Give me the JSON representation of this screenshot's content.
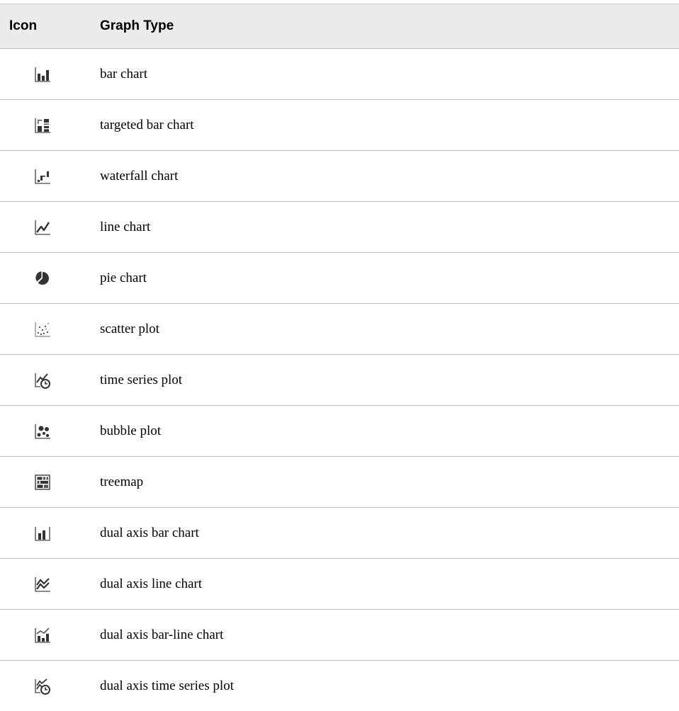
{
  "table": {
    "headers": {
      "icon": "Icon",
      "graph_type": "Graph Type"
    },
    "rows": [
      {
        "icon": "bar-chart-icon",
        "label": "bar chart"
      },
      {
        "icon": "targeted-bar-chart-icon",
        "label": "targeted bar chart"
      },
      {
        "icon": "waterfall-chart-icon",
        "label": "waterfall chart"
      },
      {
        "icon": "line-chart-icon",
        "label": "line chart"
      },
      {
        "icon": "pie-chart-icon",
        "label": "pie chart"
      },
      {
        "icon": "scatter-plot-icon",
        "label": "scatter plot"
      },
      {
        "icon": "time-series-plot-icon",
        "label": "time series plot"
      },
      {
        "icon": "bubble-plot-icon",
        "label": "bubble plot"
      },
      {
        "icon": "treemap-icon",
        "label": "treemap"
      },
      {
        "icon": "dual-axis-bar-chart-icon",
        "label": "dual axis bar chart"
      },
      {
        "icon": "dual-axis-line-chart-icon",
        "label": "dual axis line chart"
      },
      {
        "icon": "dual-axis-bar-line-chart-icon",
        "label": "dual axis bar-line chart"
      },
      {
        "icon": "dual-axis-time-series-plot-icon",
        "label": "dual axis time series plot"
      }
    ]
  },
  "colors": {
    "header_background": "#ebebeb",
    "row_divider": "#bdbdbd",
    "icon_dark": "#333333",
    "icon_mid": "#666666"
  }
}
